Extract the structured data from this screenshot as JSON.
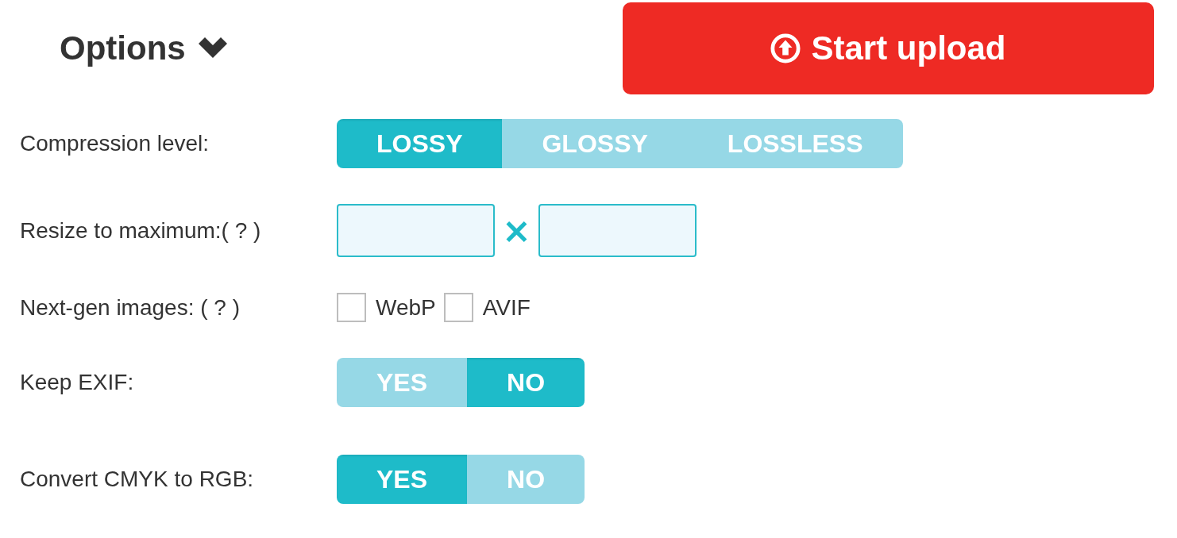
{
  "header": {
    "title": "Options",
    "expanded": true,
    "upload_button": "Start upload"
  },
  "rows": [
    {
      "kind": "segmented",
      "label": "Compression level:",
      "options": [
        {
          "label": "LOSSY",
          "selected": true
        },
        {
          "label": "GLOSSY",
          "selected": false
        },
        {
          "label": "LOSSLESS",
          "selected": false
        }
      ]
    },
    {
      "kind": "dimensions",
      "label": "Resize to maximum:( ? )",
      "separator": "×"
    },
    {
      "kind": "checkboxes",
      "label": "Next-gen images: ( ? )",
      "options": [
        {
          "label": "WebP",
          "checked": false
        },
        {
          "label": "AVIF",
          "checked": false
        }
      ]
    },
    {
      "kind": "segmented",
      "label": "Keep EXIF:",
      "options": [
        {
          "label": "YES",
          "selected": false
        },
        {
          "label": "NO",
          "selected": true
        }
      ]
    },
    {
      "kind": "segmented",
      "label": "Convert CMYK to RGB:",
      "options": [
        {
          "label": "YES",
          "selected": true
        },
        {
          "label": "NO",
          "selected": false
        }
      ]
    }
  ]
}
